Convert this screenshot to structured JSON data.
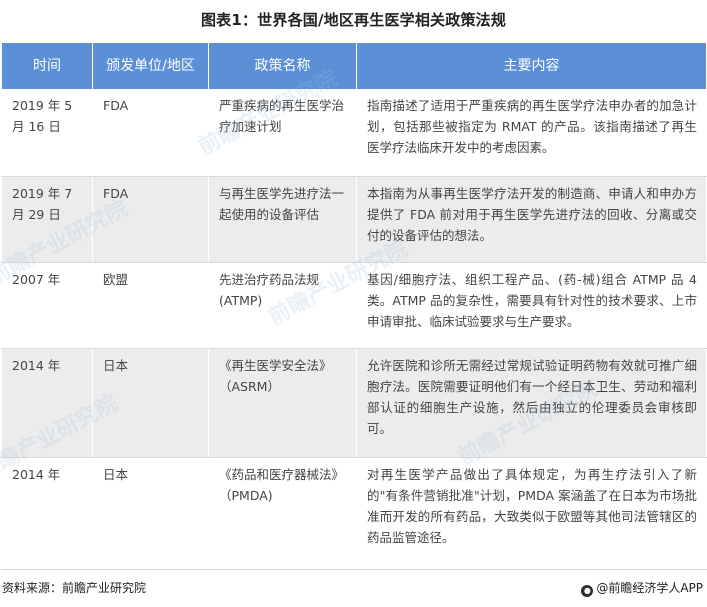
{
  "title": "图表1：世界各国/地区再生医学相关政策法规",
  "headers": [
    "时间",
    "颁发单位/地区",
    "政策名称",
    "主要内容"
  ],
  "rows": [
    {
      "date": "2019 年 5 月 16 日",
      "issuer": "FDA",
      "name": "严重疾病的再生医学治疗加速计划",
      "content": "指南描述了适用于严重疾病的再生医学疗法申办者的加急计划，包括那些被指定为 RMAT 的产品。该指南描述了再生医学疗法临床开发中的考虑因素。"
    },
    {
      "date": "2019 年 7 月 29 日",
      "issuer": "FDA",
      "name": "与再生医学先进疗法一起使用的设备评估",
      "content": "本指南为从事再生医学疗法开发的制造商、申请人和申办方提供了 FDA 前对用于再生医学先进疗法的回收、分离或交付的设备评估的想法。"
    },
    {
      "date": "2007 年",
      "issuer": "欧盟",
      "name": "先进治疗药品法规(ATMP)",
      "content": "基因/细胞疗法、组织工程产品、(药-械)组合 ATMP 品 4 类。ATMP 品的复杂性，需要具有针对性的技术要求、上市申请审批、临床试验要求与生产要求。"
    },
    {
      "date": "2014 年",
      "issuer": "日本",
      "name": "《再生医学安全法》（ASRM）",
      "content": "允许医院和诊所无需经过常规试验证明药物有效就可推广细胞疗法。医院需要证明他们有一个经日本卫生、劳动和福利部认证的细胞生产设施，然后由独立的伦理委员会审核即可。"
    },
    {
      "date": "2014 年",
      "issuer": "日本",
      "name": "《药品和医疗器械法》（PMDA)",
      "content": "对再生医学产品做出了具体规定，为再生疗法引入了新的\"有条件营销批准\"计划，PMDA 案涵盖了在日本为市场批准而开发的所有药品，大致类似于欧盟等其他司法管辖区的药品监管途径。"
    }
  ],
  "source": "资料来源：前瞻产业研究院",
  "brand": "@前瞻经济学人APP",
  "watermark": "前瞻产业研究院"
}
